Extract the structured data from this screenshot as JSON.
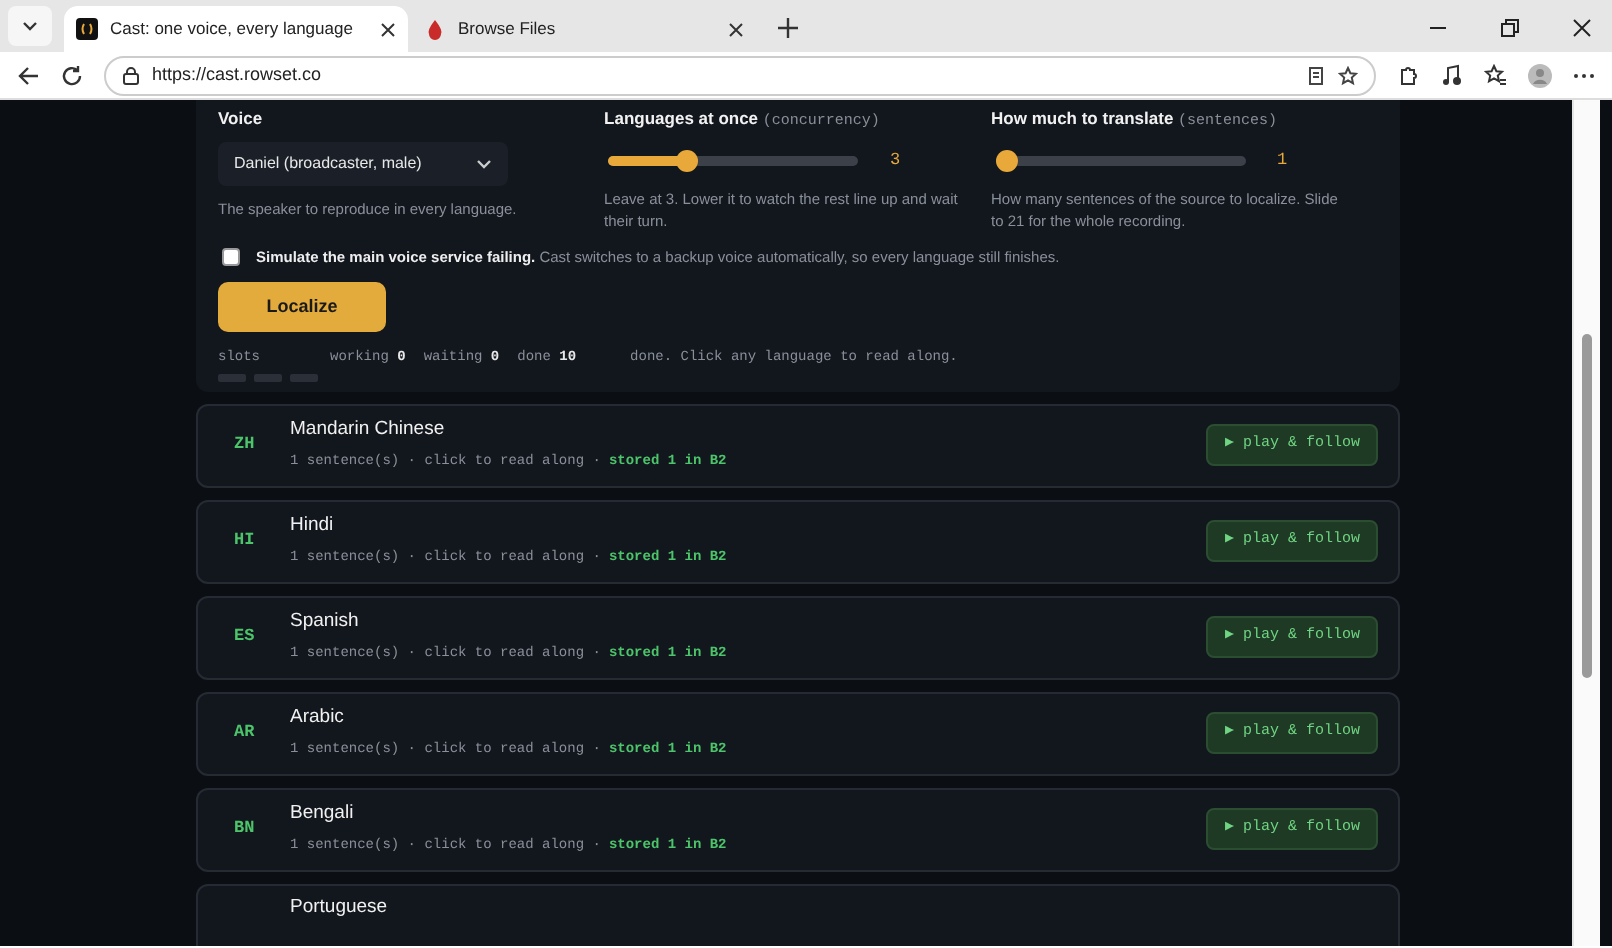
{
  "browser": {
    "tabs": [
      {
        "title": "Cast: one voice, every language",
        "selected": true
      },
      {
        "title": "Browse Files",
        "selected": false
      }
    ],
    "address": "https://cast.rowset.co"
  },
  "settings": {
    "voice": {
      "label": "Voice",
      "value": "Daniel (broadcaster, male)",
      "help": "The speaker to reproduce in every language."
    },
    "sliders": [
      {
        "label": "Languages at once",
        "unit": "(concurrency)",
        "level": 0.3,
        "reading": "3",
        "help": "Leave at 3. Lower it to watch the rest line up and wait their turn."
      },
      {
        "label": "How much to translate",
        "unit": "(sentences)",
        "level": 0,
        "reading": "1",
        "help": "How many sentences of the source to localize. Slide to 21 for the whole recording."
      }
    ],
    "failover": {
      "checked": false,
      "text": "**Simulate the main voice service failing.** Cast switches to a backup voice automatically, so every language still finishes."
    },
    "action": "Localize",
    "status": {
      "slots_label": "slots",
      "slots": [
        {
          "busy": false
        },
        {
          "busy": false
        },
        {
          "busy": false
        }
      ],
      "counters": [
        {
          "label": "working",
          "value": "0"
        },
        {
          "label": "waiting",
          "value": "0"
        },
        {
          "label": "done",
          "value": "10"
        }
      ],
      "message": "done. Click any language to read along."
    }
  },
  "languages": [
    {
      "code": "ZH",
      "name": "Mandarin Chinese",
      "detail": "1 sentence(s) · click to read along ·",
      "stored": "stored 1 in B2",
      "button": "▶ play & follow"
    },
    {
      "code": "HI",
      "name": "Hindi",
      "detail": "1 sentence(s) · click to read along ·",
      "stored": "stored 1 in B2",
      "button": "▶ play & follow"
    },
    {
      "code": "ES",
      "name": "Spanish",
      "detail": "1 sentence(s) · click to read along ·",
      "stored": "stored 1 in B2",
      "button": "▶ play & follow"
    },
    {
      "code": "AR",
      "name": "Arabic",
      "detail": "1 sentence(s) · click to read along ·",
      "stored": "stored 1 in B2",
      "button": "▶ play & follow"
    },
    {
      "code": "BN",
      "name": "Bengali",
      "detail": "1 sentence(s) · click to read along ·",
      "stored": "stored 1 in B2",
      "button": "▶ play & follow"
    },
    {
      "name": "Portuguese"
    }
  ]
}
